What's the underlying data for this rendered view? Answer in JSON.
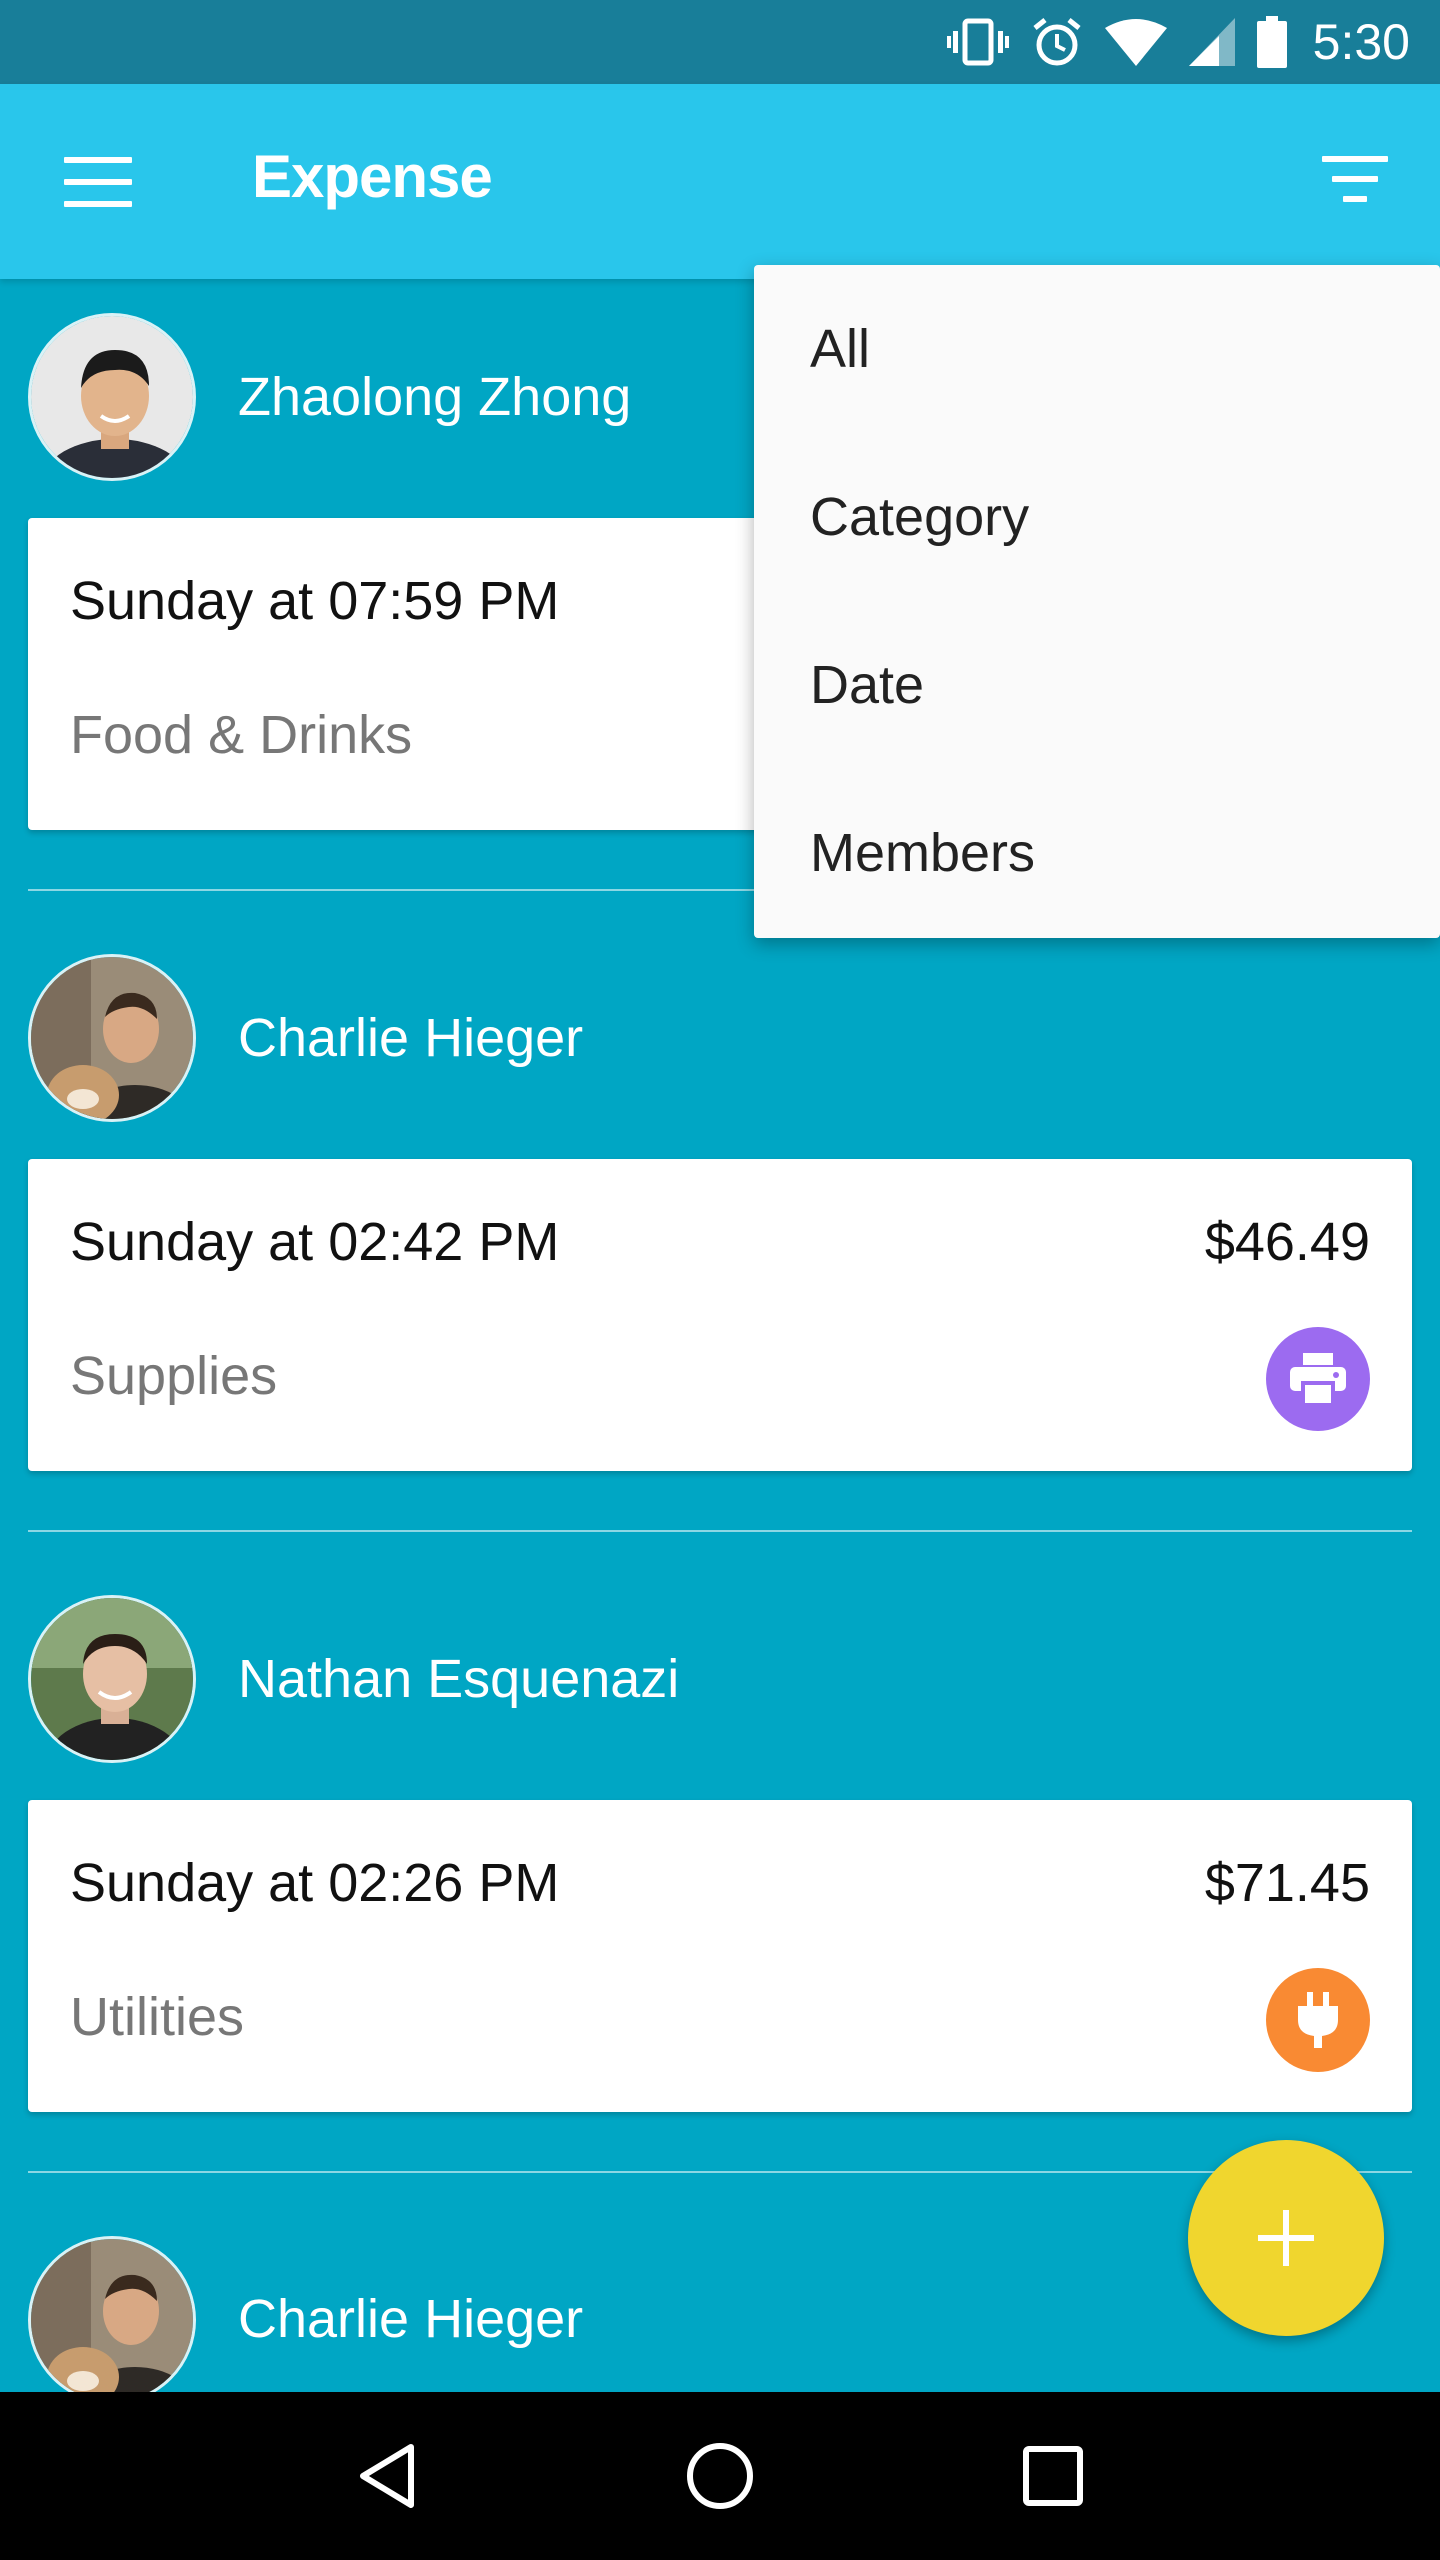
{
  "status_bar": {
    "time": "5:30"
  },
  "app_bar": {
    "title": "Expense"
  },
  "filter_menu": {
    "items": [
      "All",
      "Category",
      "Date",
      "Members"
    ]
  },
  "entries": [
    {
      "member": "Zhaolong Zhong",
      "time": "Sunday at 07:59 PM",
      "category": "Food & Drinks",
      "amount": "",
      "icon": "food-icon",
      "icon_color": ""
    },
    {
      "member": "Charlie Hieger",
      "time": "Sunday at 02:42 PM",
      "category": "Supplies",
      "amount": "$46.49",
      "icon": "printer-icon",
      "icon_color": "#9C6BF0"
    },
    {
      "member": "Nathan Esquenazi",
      "time": "Sunday at 02:26 PM",
      "category": "Utilities",
      "amount": "$71.45",
      "icon": "plug-icon",
      "icon_color": "#F98A33"
    },
    {
      "member": "Charlie Hieger"
    }
  ],
  "colors": {
    "status_bar": "#187E99",
    "app_bar": "#29C6EB",
    "background": "#00A6C4",
    "fab": "#F0D62E"
  }
}
